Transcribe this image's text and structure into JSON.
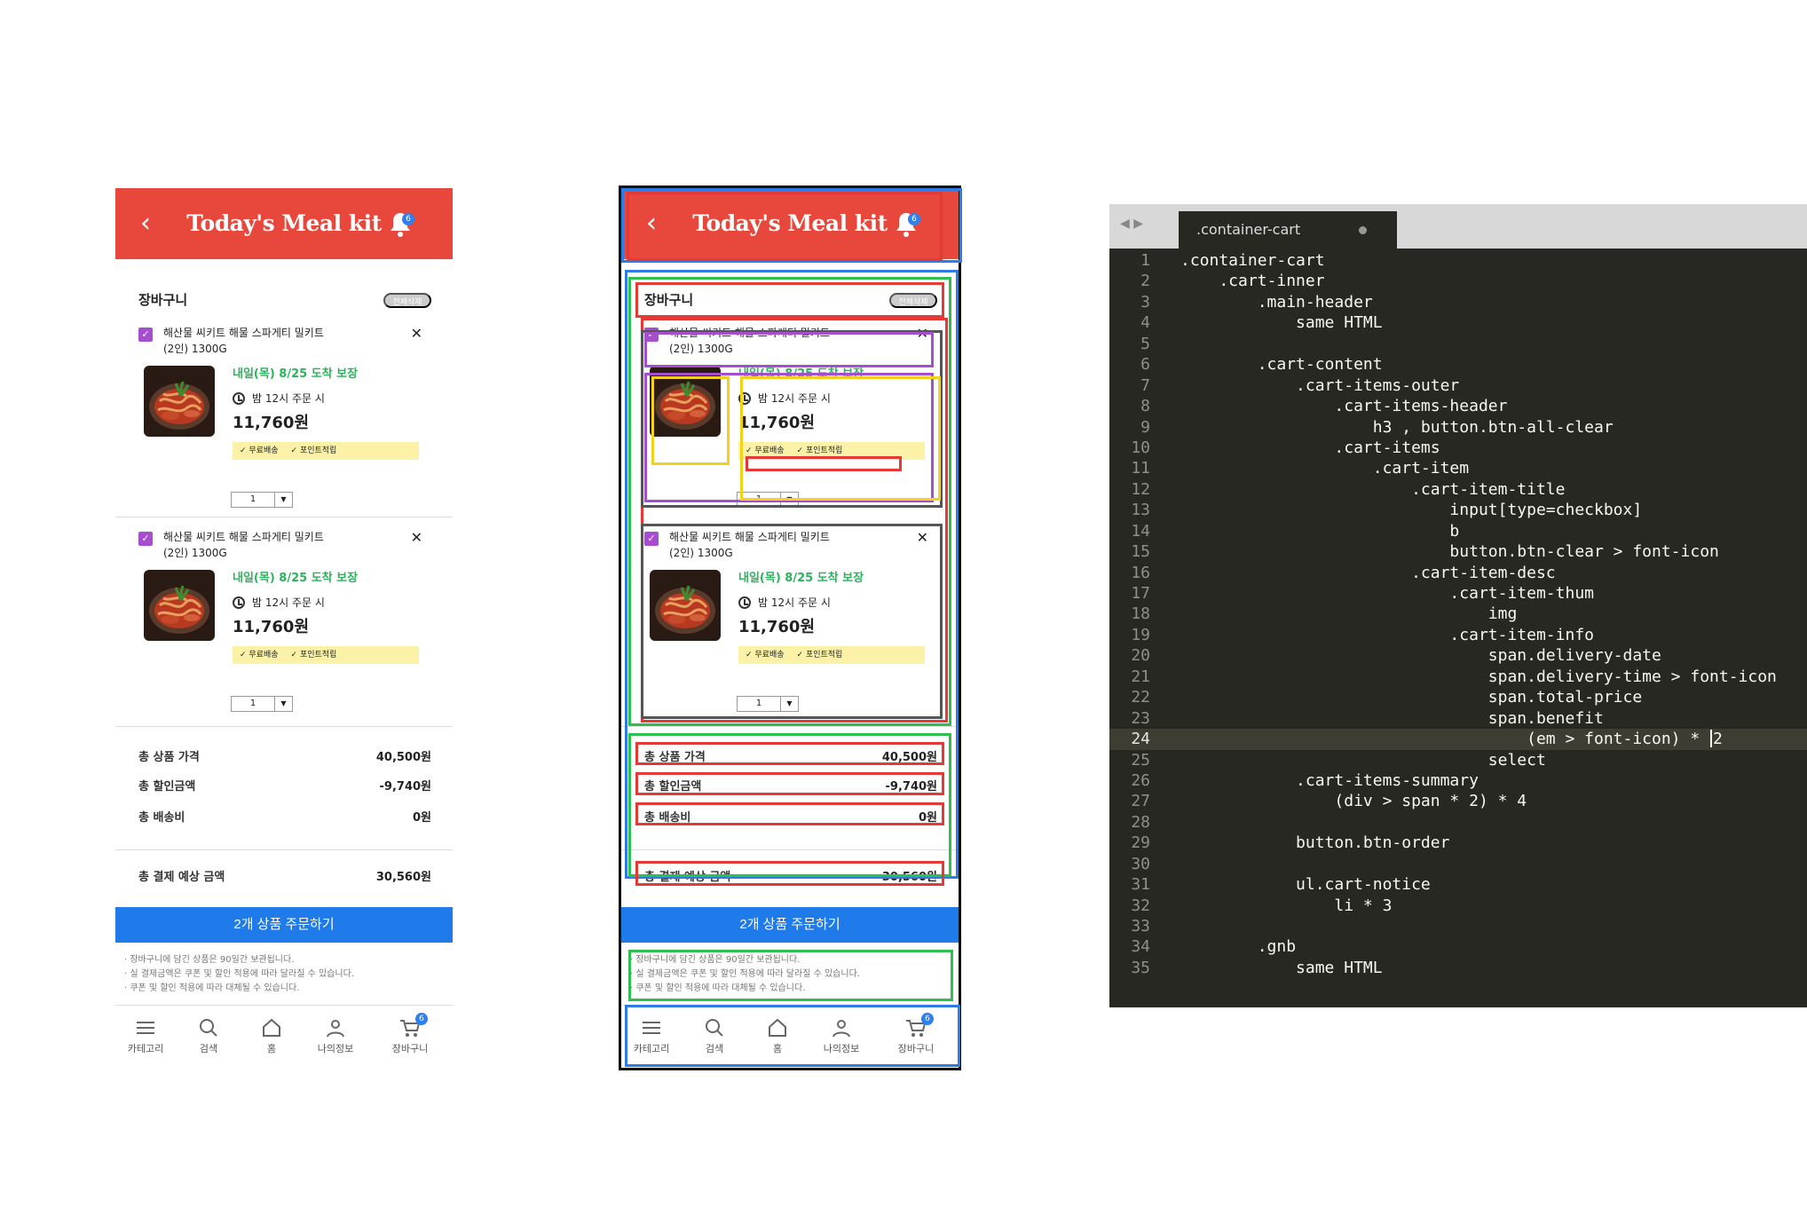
{
  "app": {
    "title": "Today's Meal kit",
    "notification_count": "6",
    "back_label": "‹"
  },
  "cart": {
    "heading": "장바구니",
    "clear_all_label": "전체삭제",
    "items": [
      {
        "name_line1": "해산물 씨키트 해물 스파게티 밀키트",
        "name_line2": "(2인) 1300G",
        "delivery_date": "내일(목) 8/25 도착 보장",
        "delivery_time": "밤 12시 주문 시",
        "price": "11,760원",
        "benefit_1": "무료배송",
        "benefit_2": "포인트적립",
        "quantity": "1",
        "checked": true
      },
      {
        "name_line1": "해산물 씨키트 해물 스파게티 밀키트",
        "name_line2": "(2인) 1300G",
        "delivery_date": "내일(목) 8/25 도착 보장",
        "delivery_time": "밤 12시 주문 시",
        "price": "11,760원",
        "benefit_1": "무료배송",
        "benefit_2": "포인트적립",
        "quantity": "1",
        "checked": true
      }
    ],
    "summary": [
      {
        "label": "총 상품 가격",
        "value": "40,500원"
      },
      {
        "label": "총 할인금액",
        "value": "-9,740원"
      },
      {
        "label": "총 배송비",
        "value": "0원"
      },
      {
        "label": "총 결제 예상 금액",
        "value": "30,560원"
      }
    ],
    "order_button": "2개 상품 주문하기",
    "notices": [
      "· 장바구니에 담긴 상품은 90일간 보관됩니다.",
      "· 실 결제금액은 쿠폰 및 할인 적용에 따라 달라질 수 있습니다.",
      "· 쿠폰 및 할인 적용에 따라 대체될 수 있습니다."
    ]
  },
  "gnb": {
    "tabs": [
      {
        "label": "카테고리",
        "icon": "menu-icon"
      },
      {
        "label": "검색",
        "icon": "search-icon"
      },
      {
        "label": "홈",
        "icon": "home-icon"
      },
      {
        "label": "나의정보",
        "icon": "user-icon"
      },
      {
        "label": "장바구니",
        "icon": "cart-icon"
      }
    ],
    "cart_badge": "6"
  },
  "annotation_colors": {
    "blue": "#2f7be6",
    "red": "#e53935",
    "green": "#2ebf4f",
    "purple": "#a64ed0",
    "yellow": "#f2d11f",
    "gray": "#555555"
  },
  "colors": {
    "header_red": "#e8483b",
    "order_blue": "#1f7aea",
    "delivery_green": "#2bb35c",
    "benefit_yellow": "#fbf2a8",
    "checkbox_purple": "#a64ed0"
  },
  "editor": {
    "tab_title": ".container-cart",
    "current_line": 24,
    "lines": [
      ".container-cart",
      "    .cart-inner",
      "        .main-header",
      "            same HTML",
      "",
      "        .cart-content",
      "            .cart-items-outer",
      "                .cart-items-header",
      "                    h3 , button.btn-all-clear",
      "                .cart-items",
      "                    .cart-item",
      "                        .cart-item-title",
      "                            input[type=checkbox]",
      "                            b",
      "                            button.btn-clear > font-icon",
      "                        .cart-item-desc",
      "                            .cart-item-thum",
      "                                img",
      "                            .cart-item-info",
      "                                span.delivery-date",
      "                                span.delivery-time > font-icon",
      "                                span.total-price",
      "                                span.benefit",
      "                                    (em > font-icon) * 2",
      "                                select",
      "            .cart-items-summary",
      "                (div > span * 2) * 4",
      "",
      "            button.btn-order",
      "",
      "            ul.cart-notice",
      "                li * 3",
      "",
      "        .gnb",
      "            same HTML"
    ]
  }
}
